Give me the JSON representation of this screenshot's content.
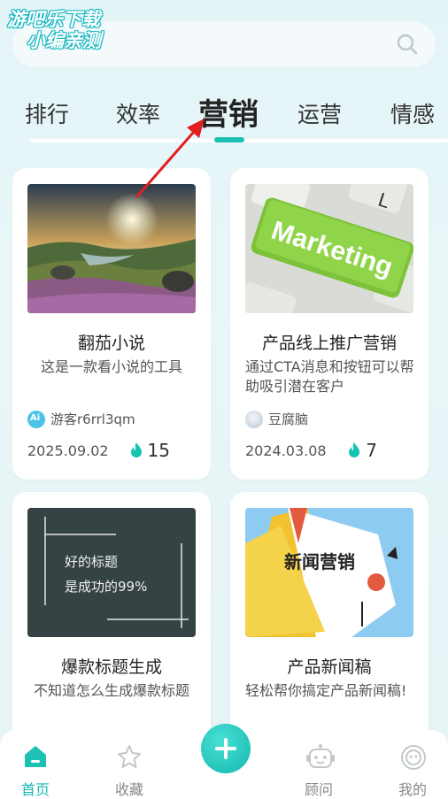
{
  "watermark": {
    "line1": "游吧乐下载",
    "line2": "小编亲测"
  },
  "search": {
    "icon": "search-icon"
  },
  "tabs": [
    {
      "label": "排行"
    },
    {
      "label": "效率"
    },
    {
      "label": "营销",
      "active": true
    },
    {
      "label": "运营"
    },
    {
      "label": "情感"
    }
  ],
  "cards": [
    {
      "title": "翻茄小说",
      "desc": "这是一款看小说的工具",
      "author": "游客r6rrl3qm",
      "date": "2025.09.02",
      "hot": "15"
    },
    {
      "title": "产品线上推广营销",
      "desc": "通过CTA消息和按钮可以帮助吸引潜在客户",
      "author": "豆腐脑",
      "date": "2024.03.08",
      "hot": "7",
      "image_text": "Marketing"
    },
    {
      "title": "爆款标题生成",
      "desc": "不知道怎么生成爆款标题",
      "image_text_1": "好的标题",
      "image_text_2": "是成功的99%"
    },
    {
      "title": "产品新闻稿",
      "desc": "轻松帮你搞定产品新闻稿!",
      "image_text": "新闻营销"
    }
  ],
  "nav": [
    {
      "label": "首页",
      "icon": "home-icon",
      "active": true
    },
    {
      "label": "收藏",
      "icon": "star-icon"
    },
    {
      "label": "",
      "icon": "plus-icon"
    },
    {
      "label": "顾问",
      "icon": "robot-icon"
    },
    {
      "label": "我的",
      "icon": "profile-icon"
    }
  ],
  "colors": {
    "accent": "#1cc1b4",
    "flame": "#17c3b2",
    "arrow": "#e02020"
  }
}
